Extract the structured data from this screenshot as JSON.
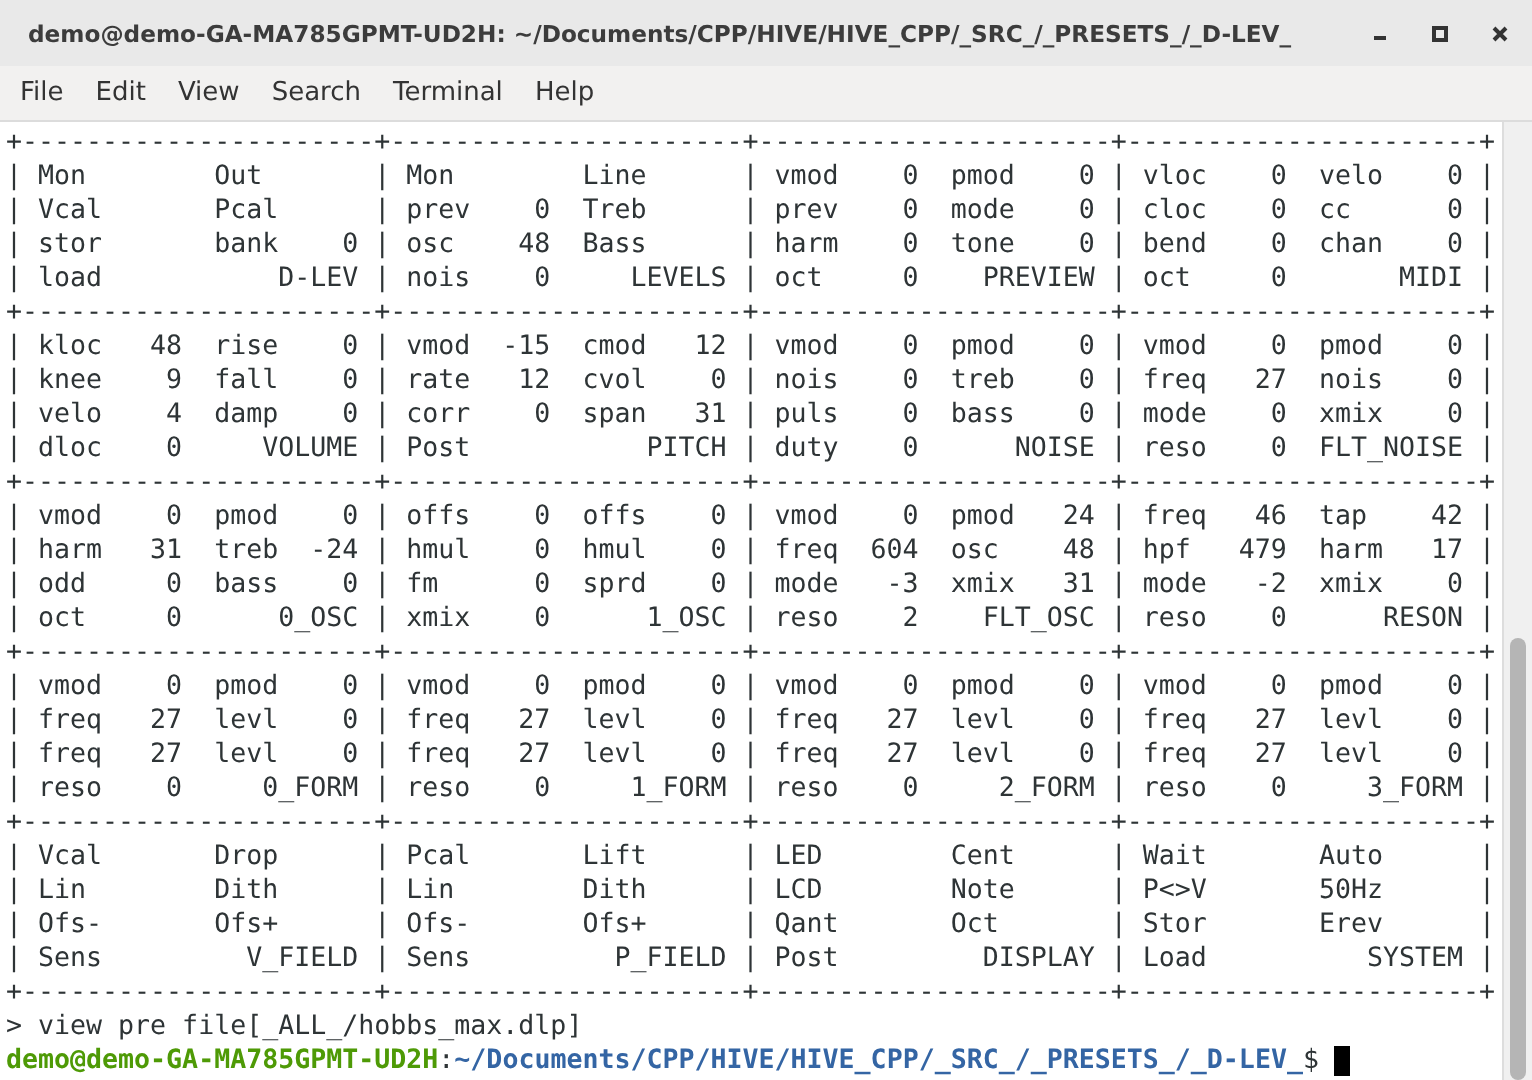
{
  "window": {
    "title": "demo@demo-GA-MA785GPMT-UD2H: ~/Documents/CPP/HIVE/HIVE_CPP/_SRC_/_PRESETS_/_D-LEV_"
  },
  "menu": [
    "File",
    "Edit",
    "View",
    "Search",
    "Terminal",
    "Help"
  ],
  "terminal": {
    "lines": [
      "+----------------------+----------------------+----------------------+----------------------+",
      "| Mon        Out       | Mon        Line      | vmod    0  pmod    0 | vloc    0  velo    0 |",
      "| Vcal       Pcal      | prev    0  Treb      | prev    0  mode    0 | cloc    0  cc      0 |",
      "| stor       bank    0 | osc    48  Bass      | harm    0  tone    0 | bend    0  chan    0 |",
      "| load           D-LEV | nois    0     LEVELS | oct     0    PREVIEW | oct     0       MIDI |",
      "+----------------------+----------------------+----------------------+----------------------+",
      "| kloc   48  rise    0 | vmod  -15  cmod   12 | vmod    0  pmod    0 | vmod    0  pmod    0 |",
      "| knee    9  fall    0 | rate   12  cvol    0 | nois    0  treb    0 | freq   27  nois    0 |",
      "| velo    4  damp    0 | corr    0  span   31 | puls    0  bass    0 | mode    0  xmix    0 |",
      "| dloc    0     VOLUME | Post           PITCH | duty    0      NOISE | reso    0  FLT_NOISE |",
      "+----------------------+----------------------+----------------------+----------------------+",
      "| vmod    0  pmod    0 | offs    0  offs    0 | vmod    0  pmod   24 | freq   46  tap    42 |",
      "| harm   31  treb  -24 | hmul    0  hmul    0 | freq  604  osc    48 | hpf   479  harm   17 |",
      "| odd     0  bass    0 | fm      0  sprd    0 | mode   -3  xmix   31 | mode   -2  xmix    0 |",
      "| oct     0      0_OSC | xmix    0      1_OSC | reso    2    FLT_OSC | reso    0      RESON |",
      "+----------------------+----------------------+----------------------+----------------------+",
      "| vmod    0  pmod    0 | vmod    0  pmod    0 | vmod    0  pmod    0 | vmod    0  pmod    0 |",
      "| freq   27  levl    0 | freq   27  levl    0 | freq   27  levl    0 | freq   27  levl    0 |",
      "| freq   27  levl    0 | freq   27  levl    0 | freq   27  levl    0 | freq   27  levl    0 |",
      "| reso    0     0_FORM | reso    0     1_FORM | reso    0     2_FORM | reso    0     3_FORM |",
      "+----------------------+----------------------+----------------------+----------------------+",
      "| Vcal       Drop      | Pcal       Lift      | LED        Cent      | Wait       Auto      |",
      "| Lin        Dith      | Lin        Dith      | LCD        Note      | P<>V       50Hz      |",
      "| Ofs-       Ofs+      | Ofs-       Ofs+      | Qant       Oct       | Stor       Erev      |",
      "| Sens         V_FIELD | Sens         P_FIELD | Post         DISPLAY | Load          SYSTEM |",
      "+----------------------+----------------------+----------------------+----------------------+",
      "> view pre file[_ALL_/hobbs_max.dlp]"
    ],
    "prompt": {
      "user_host": "demo@demo-GA-MA785GPMT-UD2H",
      "separator": ":",
      "path": "~/Documents/CPP/HIVE/HIVE_CPP/_SRC_/_PRESETS_/_D-LEV_",
      "symbol": "$"
    }
  }
}
